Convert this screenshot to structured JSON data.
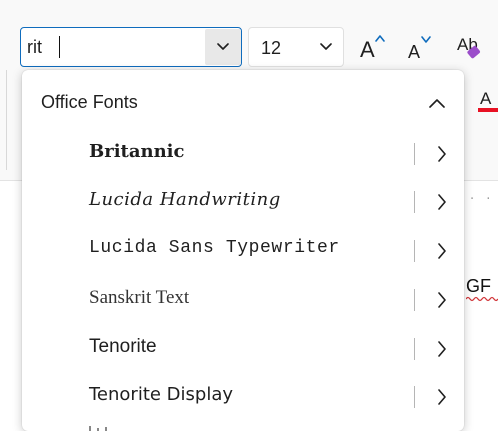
{
  "toolbar": {
    "font_name_value": "rit",
    "font_size_value": "12"
  },
  "icons": {
    "font_dropdown": "chevron-down-icon",
    "size_dropdown": "chevron-down-icon",
    "grow_font": "increase-font-size-icon",
    "shrink_font": "decrease-font-size-icon",
    "clear_formatting": "clear-formatting-icon",
    "font_color": "font-color-icon",
    "collapse": "chevron-up-icon",
    "submenu": "chevron-right-icon"
  },
  "colors": {
    "accent": "#0f6cbd",
    "font_color_bar": "#e81123",
    "eraser": "#9b4dca"
  },
  "dropdown": {
    "section_title": "Office Fonts",
    "fonts": [
      {
        "name": "Britannic"
      },
      {
        "name": "Lucida Handwriting"
      },
      {
        "name": "Lucida Sans Typewriter"
      },
      {
        "name": "Sanskrit Text"
      },
      {
        "name": "Tenorite"
      },
      {
        "name": "Tenorite Display"
      }
    ]
  },
  "document": {
    "visible_text": "GF"
  }
}
